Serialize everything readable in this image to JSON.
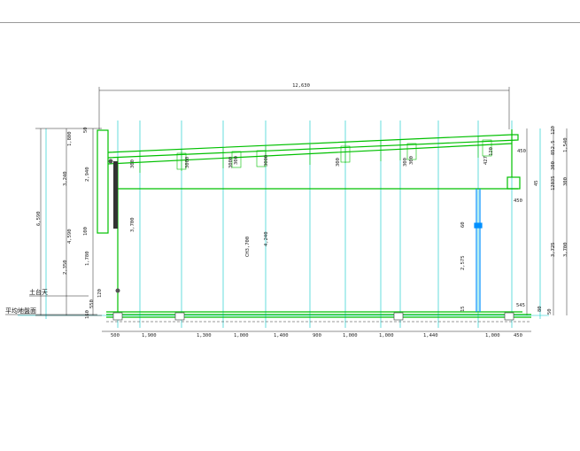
{
  "drawing": {
    "overall_width": "12,630",
    "bottom_dims": [
      "500",
      "1,900",
      "1,300",
      "1,000",
      "1,400",
      "900",
      "1,000",
      "1,000",
      "1,440",
      "1,000",
      "450"
    ],
    "left_dims": [
      "1,800",
      "2,940",
      "3,240",
      "6,590",
      "4,590",
      "3,700",
      "1,780",
      "2,350",
      "50",
      "550",
      "160",
      "120",
      "100"
    ],
    "right_dims": [
      "450",
      "120",
      "852.5",
      "1,540",
      "300",
      "12035",
      "45",
      "300",
      "450",
      "3,725",
      "3,700",
      "545",
      "80",
      "50"
    ],
    "section_labels": [
      "300",
      "3000",
      "3000",
      "300",
      "3000",
      "300",
      "300",
      "300",
      "427",
      "120"
    ],
    "center_dims": [
      "CH3,700",
      "4,240",
      "2,575",
      "60",
      "15"
    ],
    "ground_label_1": "土台天",
    "ground_label_2": "平均地盤面",
    "colors": {
      "structure": "#00c000",
      "grid": "#00c8c8",
      "dimension": "#222222",
      "post": "#0090ff"
    }
  }
}
